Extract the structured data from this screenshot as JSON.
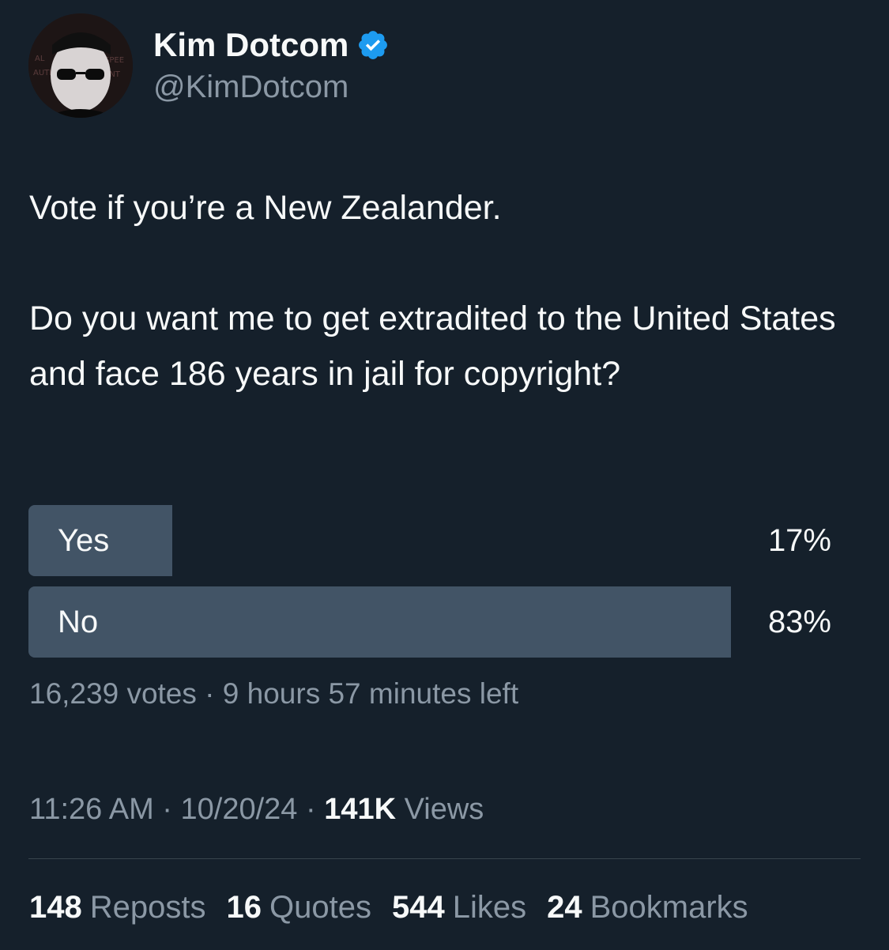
{
  "author": {
    "name": "Kim Dotcom",
    "handle": "@KimDotcom",
    "verified_icon": "verified-badge-icon",
    "verified_color": "#1d9bf0"
  },
  "tweet": {
    "line1": "Vote if you’re a New Zealander.",
    "line2": "Do you want me to get extradited to the United States and face 186 years in jail for copyright?"
  },
  "poll": {
    "options": [
      {
        "label": "Yes",
        "percent_text": "17%",
        "share": 0.17
      },
      {
        "label": "No",
        "percent_text": "83%",
        "share": 0.83
      }
    ],
    "votes": "16,239 votes",
    "separator": "·",
    "time_left": "9 hours 57 minutes left",
    "bar_color": "#425466"
  },
  "meta": {
    "time": "11:26 AM",
    "date": "10/20/24",
    "separator": "·",
    "views_count": "141K",
    "views_label": "Views"
  },
  "stats": {
    "reposts_count": "148",
    "reposts_label": "Reposts",
    "quotes_count": "16",
    "quotes_label": "Quotes",
    "likes_count": "544",
    "likes_label": "Likes",
    "bookmarks_count": "24",
    "bookmarks_label": "Bookmarks"
  },
  "colors": {
    "background": "#15202b",
    "text_primary": "#f7f9f9",
    "text_secondary": "#8b98a5",
    "divider": "#38444d"
  }
}
